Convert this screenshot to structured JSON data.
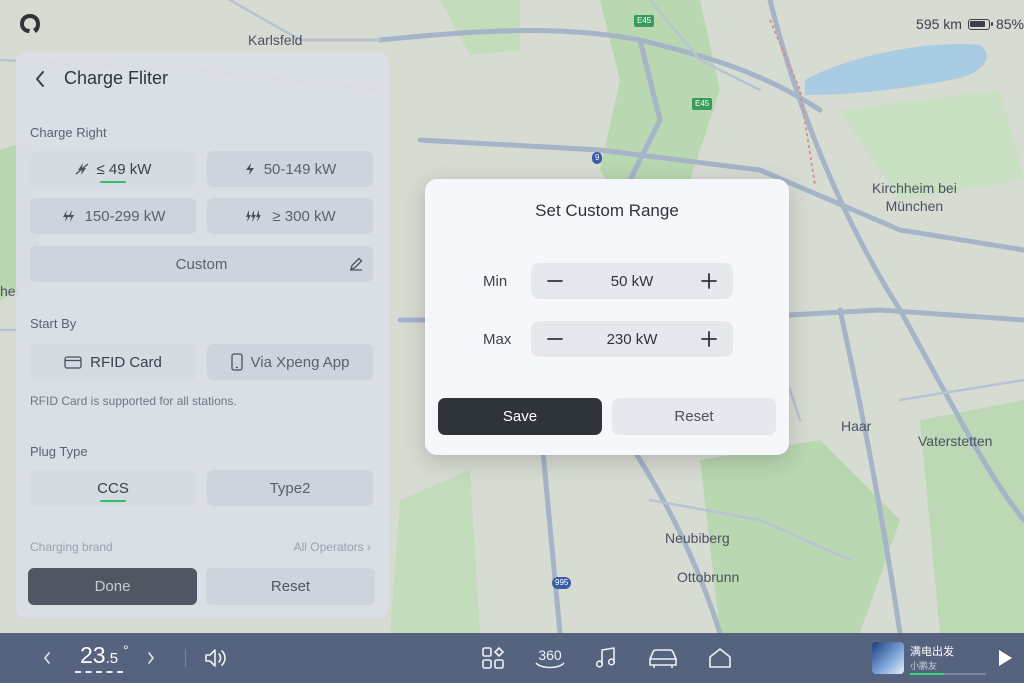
{
  "map": {
    "labels": {
      "karlsfeld": "Karlsfeld",
      "kirchheim": "Kirchheim bei\nMünchen",
      "haar": "Haar",
      "vaterstetten": "Vaterstetten",
      "neubiberg": "Neubiberg",
      "ottobrunn": "Ottobrunn",
      "edge_left": "hei"
    },
    "road_badges": {
      "e45_top": "E45",
      "e45_mid": "E45",
      "a9": "9",
      "a995": "995"
    },
    "colors": {
      "land": "#d7dcd3",
      "green": "#b9d7b1",
      "road": "#a6b4c7",
      "water": "#a9cce3"
    }
  },
  "status": {
    "range": "595 km",
    "battery": "85%"
  },
  "filter_panel": {
    "title": "Charge Fliter",
    "charge_right": {
      "label": "Charge Right",
      "options": [
        "≤ 49 kW",
        "50-149 kW",
        "150-299 kW",
        "≥ 300 kW"
      ],
      "selected": 0,
      "custom": "Custom"
    },
    "start_by": {
      "label": "Start By",
      "options": [
        "RFID Card",
        "Via Xpeng App"
      ],
      "selected": 0,
      "hint": "RFID Card is supported for all stations."
    },
    "plug_type": {
      "label": "Plug Type",
      "options": [
        "CCS",
        "Type2"
      ],
      "selected": 0
    },
    "charging_brand": {
      "label": "Charging brand",
      "value": "All Operators"
    },
    "done_label": "Done",
    "reset_label": "Reset"
  },
  "dialog": {
    "title": "Set Custom Range",
    "min": {
      "label": "Min",
      "value": "50 kW"
    },
    "max": {
      "label": "Max",
      "value": "230 kW"
    },
    "save_label": "Save",
    "reset_label": "Reset"
  },
  "bottom_bar": {
    "temperature": "23",
    "temperature_decimal": ".5",
    "degree": "°",
    "media": {
      "title": "满电出发",
      "subtitle": "小鹏友",
      "progress": 0.45
    },
    "icons": [
      "chevron-left-icon",
      "chevron-right-icon",
      "volume-icon",
      "apps-icon",
      "camera-360-icon",
      "music-icon",
      "car-icon",
      "home-icon",
      "play-icon"
    ],
    "label_360": "360"
  },
  "accent": "#2fbf71"
}
